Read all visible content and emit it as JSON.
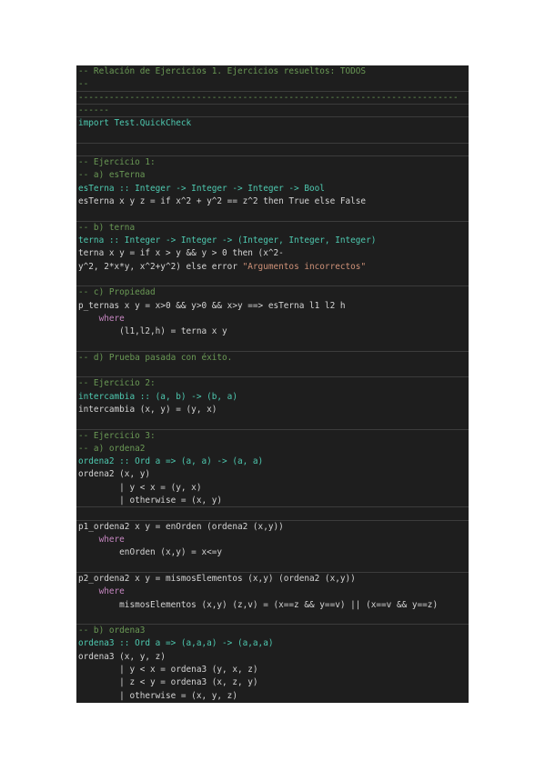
{
  "lines": [
    {
      "text": "-- Relación de Ejercicios 1. Ejercicios resueltos: TODOS",
      "kind": "comment"
    },
    {
      "text": "--",
      "kind": "comment"
    },
    {
      "text": "--------------------------------------------------------------------------",
      "kind": "comment"
    },
    {
      "text": "------",
      "kind": "comment"
    },
    {
      "text": "import Test.QuickCheck",
      "kind": "import"
    },
    {
      "text": "",
      "kind": "blank"
    },
    {
      "text": "",
      "kind": "blank"
    },
    {
      "text": "-- Ejercicio 1:",
      "kind": "comment"
    },
    {
      "text": "-- a) esTerna",
      "kind": "comment"
    },
    {
      "text": "esTerna :: Integer -> Integer -> Integer -> Bool",
      "kind": "sig"
    },
    {
      "text": "esTerna x y z = if x^2 + y^2 == z^2 then True else False",
      "kind": "code"
    },
    {
      "text": "",
      "kind": "blank"
    },
    {
      "text": "-- b) terna",
      "kind": "comment"
    },
    {
      "text": "terna :: Integer -> Integer -> (Integer, Integer, Integer)",
      "kind": "sig"
    },
    {
      "text": "terna x y = if x > y && y > 0 then (x^2-",
      "kind": "code"
    },
    {
      "text": "y^2, 2*x*y, x^2+y^2) else error \"Argumentos incorrectos\"",
      "kind": "code"
    },
    {
      "text": "",
      "kind": "blank"
    },
    {
      "text": "-- c) Propiedad",
      "kind": "comment"
    },
    {
      "text": "p_ternas x y = x>0 && y>0 && x>y ==> esTerna l1 l2 h",
      "kind": "code"
    },
    {
      "text": "    where",
      "kind": "kwline"
    },
    {
      "text": "        (l1,l2,h) = terna x y",
      "kind": "code"
    },
    {
      "text": "",
      "kind": "blank"
    },
    {
      "text": "-- d) Prueba pasada con éxito.",
      "kind": "comment"
    },
    {
      "text": "",
      "kind": "blank"
    },
    {
      "text": "-- Ejercicio 2:",
      "kind": "comment"
    },
    {
      "text": "intercambia :: (a, b) -> (b, a)",
      "kind": "sig"
    },
    {
      "text": "intercambia (x, y) = (y, x)",
      "kind": "code"
    },
    {
      "text": "",
      "kind": "blank"
    },
    {
      "text": "-- Ejercicio 3:",
      "kind": "comment"
    },
    {
      "text": "-- a) ordena2",
      "kind": "comment"
    },
    {
      "text": "ordena2 :: Ord a => (a, a) -> (a, a)",
      "kind": "sig"
    },
    {
      "text": "ordena2 (x, y)",
      "kind": "code"
    },
    {
      "text": "        | y < x = (y, x)",
      "kind": "code"
    },
    {
      "text": "        | otherwise = (x, y)",
      "kind": "code"
    },
    {
      "text": "",
      "kind": "blank"
    },
    {
      "text": "p1_ordena2 x y = enOrden (ordena2 (x,y))",
      "kind": "code"
    },
    {
      "text": "    where",
      "kind": "kwline"
    },
    {
      "text": "        enOrden (x,y) = x<=y",
      "kind": "code"
    },
    {
      "text": "",
      "kind": "blank"
    },
    {
      "text": "p2_ordena2 x y = mismosElementos (x,y) (ordena2 (x,y))",
      "kind": "code"
    },
    {
      "text": "    where",
      "kind": "kwline"
    },
    {
      "text": "        mismosElementos (x,y) (z,v) = (x==z && y==v) || (x==v && y==z)",
      "kind": "code"
    },
    {
      "text": "",
      "kind": "blank"
    },
    {
      "text": "-- b) ordena3",
      "kind": "comment"
    },
    {
      "text": "ordena3 :: Ord a => (a,a,a) -> (a,a,a)",
      "kind": "sig"
    },
    {
      "text": "ordena3 (x, y, z)",
      "kind": "code"
    },
    {
      "text": "        | y < x = ordena3 (y, x, z)",
      "kind": "code"
    },
    {
      "text": "        | z < y = ordena3 (x, z, y)",
      "kind": "code"
    },
    {
      "text": "        | otherwise = (x, y, z)",
      "kind": "code"
    }
  ],
  "colors": {
    "background": "#1e1e1e",
    "comment": "#6a9955",
    "type": "#4ec9b0",
    "keyword": "#c586c0",
    "string": "#ce9178",
    "text": "#d4d4d4"
  }
}
